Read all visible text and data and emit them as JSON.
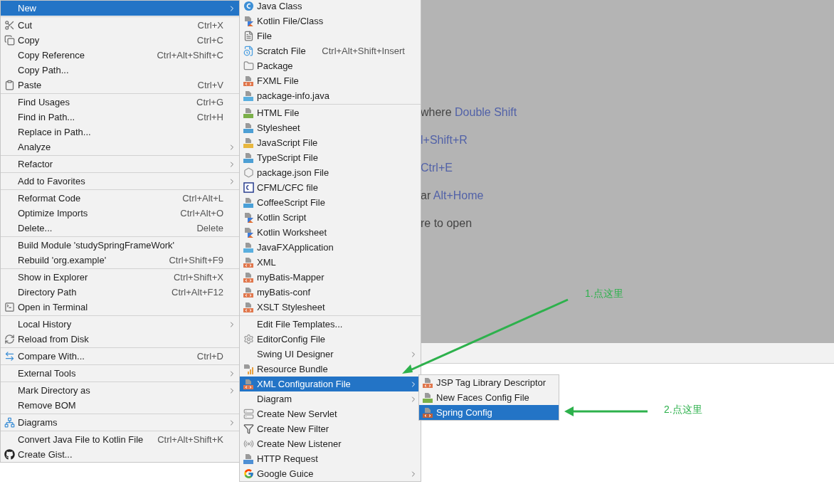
{
  "editor_hints": [
    {
      "text": "where",
      "shortcut": "Double Shift"
    },
    {
      "shortcut": "l+Shift+R"
    },
    {
      "shortcut": "Ctrl+E"
    },
    {
      "text": "ar",
      "shortcut": "Alt+Home"
    },
    {
      "text": "re to open"
    }
  ],
  "context_menu": {
    "items": [
      {
        "label": "New",
        "submenu": true,
        "selected": true
      },
      {
        "kind": "separator"
      },
      {
        "label": "Cut",
        "shortcut": "Ctrl+X",
        "kind": "cut",
        "selected": false
      },
      {
        "label": "Copy",
        "shortcut": "Ctrl+C",
        "kind": "copy",
        "selected": false
      },
      {
        "label": "Copy Reference",
        "shortcut": "Ctrl+Alt+Shift+C",
        "selected": false
      },
      {
        "label": "Copy Path...",
        "selected": false
      },
      {
        "label": "Paste",
        "shortcut": "Ctrl+V",
        "kind": "paste",
        "selected": false
      },
      {
        "kind": "separator"
      },
      {
        "label": "Find Usages",
        "shortcut": "Ctrl+G",
        "selected": false
      },
      {
        "label": "Find in Path...",
        "shortcut": "Ctrl+H",
        "selected": false
      },
      {
        "label": "Replace in Path...",
        "selected": false
      },
      {
        "label": "Analyze",
        "submenu": true,
        "selected": false
      },
      {
        "kind": "separator"
      },
      {
        "label": "Refactor",
        "submenu": true,
        "selected": false
      },
      {
        "kind": "separator"
      },
      {
        "label": "Add to Favorites",
        "submenu": true,
        "selected": false
      },
      {
        "kind": "separator"
      },
      {
        "label": "Reformat Code",
        "shortcut": "Ctrl+Alt+L",
        "selected": false
      },
      {
        "label": "Optimize Imports",
        "shortcut": "Ctrl+Alt+O",
        "selected": false
      },
      {
        "label": "Delete...",
        "shortcut": "Delete",
        "selected": false
      },
      {
        "kind": "separator"
      },
      {
        "label": "Build Module 'studySpringFrameWork'",
        "selected": false
      },
      {
        "label": "Rebuild 'org.example'",
        "shortcut": "Ctrl+Shift+F9",
        "selected": false
      },
      {
        "kind": "separator"
      },
      {
        "label": "Show in Explorer",
        "shortcut": "Ctrl+Shift+X",
        "selected": false
      },
      {
        "label": "Directory Path",
        "shortcut": "Ctrl+Alt+F12",
        "selected": false
      },
      {
        "label": "Open in Terminal",
        "kind": "terminal",
        "selected": false
      },
      {
        "kind": "separator"
      },
      {
        "label": "Local History",
        "submenu": true,
        "selected": false
      },
      {
        "label": "Reload from Disk",
        "kind": "reload",
        "selected": false
      },
      {
        "kind": "separator"
      },
      {
        "label": "Compare With...",
        "shortcut": "Ctrl+D",
        "kind": "compare",
        "selected": false
      },
      {
        "kind": "separator"
      },
      {
        "label": "External Tools",
        "submenu": true,
        "selected": false
      },
      {
        "kind": "separator"
      },
      {
        "label": "Mark Directory as",
        "submenu": true,
        "selected": false
      },
      {
        "label": "Remove BOM",
        "selected": false
      },
      {
        "kind": "separator"
      },
      {
        "label": "Diagrams",
        "submenu": true,
        "kind": "diagrams",
        "selected": false
      },
      {
        "kind": "separator"
      },
      {
        "label": "Convert Java File to Kotlin File",
        "shortcut": "Ctrl+Alt+Shift+K",
        "selected": false
      },
      {
        "label": "Create Gist...",
        "kind": "github",
        "selected": false
      }
    ]
  },
  "new_submenu": {
    "items": [
      {
        "label": "Java Class",
        "kind": "class",
        "selected": false
      },
      {
        "label": "Kotlin File/Class",
        "kind": "kotlin",
        "selected": false
      },
      {
        "label": "File",
        "kind": "file",
        "selected": false
      },
      {
        "label": "Scratch File",
        "shortcut": "Ctrl+Alt+Shift+Insert",
        "kind": "scratch",
        "selected": false
      },
      {
        "label": "Package",
        "kind": "package",
        "selected": false
      },
      {
        "label": "FXML File",
        "kind": "xml",
        "selected": false
      },
      {
        "label": "package-info.java",
        "kind": "java",
        "selected": false
      },
      {
        "kind": "separator"
      },
      {
        "label": "HTML File",
        "kind": "html",
        "selected": false
      },
      {
        "label": "Stylesheet",
        "kind": "css",
        "selected": false
      },
      {
        "label": "JavaScript File",
        "kind": "js",
        "selected": false
      },
      {
        "label": "TypeScript File",
        "kind": "ts",
        "selected": false
      },
      {
        "label": "package.json File",
        "kind": "hexagon",
        "selected": false
      },
      {
        "label": "CFML/CFC file",
        "kind": "cfml",
        "selected": false
      },
      {
        "label": "CoffeeScript File",
        "kind": "coffee",
        "selected": false
      },
      {
        "label": "Kotlin Script",
        "kind": "kotlin",
        "selected": false
      },
      {
        "label": "Kotlin Worksheet",
        "kind": "kotlin",
        "selected": false
      },
      {
        "label": "JavaFXApplication",
        "kind": "java",
        "selected": false
      },
      {
        "label": "XML",
        "kind": "xml",
        "selected": false
      },
      {
        "label": "myBatis-Mapper",
        "kind": "xml",
        "selected": false
      },
      {
        "label": "myBatis-conf",
        "kind": "xml",
        "selected": false
      },
      {
        "label": "XSLT Stylesheet",
        "kind": "xml",
        "selected": false
      },
      {
        "kind": "separator"
      },
      {
        "label": "Edit File Templates...",
        "selected": false
      },
      {
        "label": "EditorConfig File",
        "kind": "gear",
        "selected": false
      },
      {
        "label": "Swing UI Designer",
        "submenu": true,
        "selected": false
      },
      {
        "label": "Resource Bundle",
        "kind": "bundle",
        "selected": false
      },
      {
        "label": "XML Configuration File",
        "kind": "xml",
        "submenu": true,
        "selected": true
      },
      {
        "label": "Diagram",
        "submenu": true,
        "selected": false
      },
      {
        "label": "Create New Servlet",
        "kind": "servlet",
        "selected": false
      },
      {
        "label": "Create New Filter",
        "kind": "filter",
        "selected": false
      },
      {
        "label": "Create New Listener",
        "kind": "listener",
        "selected": false
      },
      {
        "label": "HTTP Request",
        "kind": "api",
        "selected": false
      },
      {
        "label": "Google Guice",
        "kind": "google",
        "submenu": true,
        "selected": false
      }
    ]
  },
  "xml_submenu": {
    "items": [
      {
        "label": "JSP Tag Library Descriptor",
        "kind": "xml",
        "selected": false
      },
      {
        "label": "New Faces Config File",
        "kind": "jsf",
        "selected": false
      },
      {
        "label": "Spring Config",
        "kind": "spring",
        "selected": true
      }
    ]
  },
  "annotations": [
    {
      "label": "1.点这里"
    },
    {
      "label": "2.点这里"
    }
  ]
}
